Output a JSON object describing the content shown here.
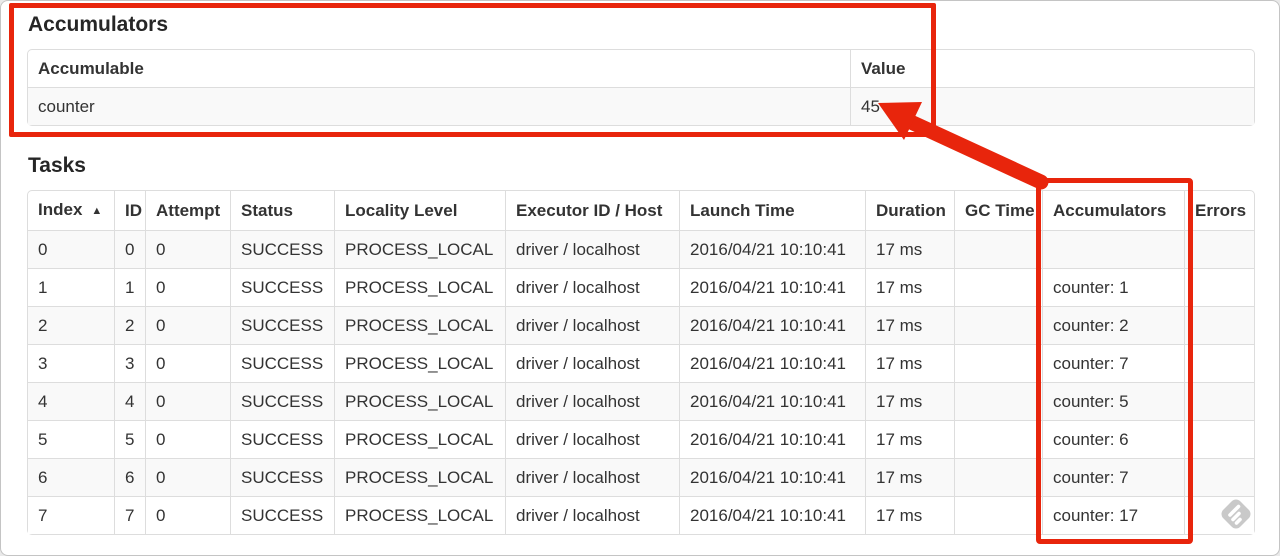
{
  "annotation": {
    "color": "#e8250c"
  },
  "watermark": {
    "color": "#c9c9c9"
  },
  "accumulators_section": {
    "title": "Accumulators",
    "table": {
      "columns": [
        "Accumulable",
        "Value"
      ],
      "rows": [
        [
          "counter",
          "45"
        ]
      ]
    }
  },
  "tasks_section": {
    "title": "Tasks",
    "table": {
      "columns": [
        "Index",
        "ID",
        "Attempt",
        "Status",
        "Locality Level",
        "Executor ID / Host",
        "Launch Time",
        "Duration",
        "GC Time",
        "Accumulators",
        "Errors"
      ],
      "sort_column": "Index",
      "sort_icon": "▲",
      "rows": [
        [
          "0",
          "0",
          "0",
          "SUCCESS",
          "PROCESS_LOCAL",
          "driver / localhost",
          "2016/04/21 10:10:41",
          "17 ms",
          "",
          "",
          ""
        ],
        [
          "1",
          "1",
          "0",
          "SUCCESS",
          "PROCESS_LOCAL",
          "driver / localhost",
          "2016/04/21 10:10:41",
          "17 ms",
          "",
          "counter: 1",
          ""
        ],
        [
          "2",
          "2",
          "0",
          "SUCCESS",
          "PROCESS_LOCAL",
          "driver / localhost",
          "2016/04/21 10:10:41",
          "17 ms",
          "",
          "counter: 2",
          ""
        ],
        [
          "3",
          "3",
          "0",
          "SUCCESS",
          "PROCESS_LOCAL",
          "driver / localhost",
          "2016/04/21 10:10:41",
          "17 ms",
          "",
          "counter: 7",
          ""
        ],
        [
          "4",
          "4",
          "0",
          "SUCCESS",
          "PROCESS_LOCAL",
          "driver / localhost",
          "2016/04/21 10:10:41",
          "17 ms",
          "",
          "counter: 5",
          ""
        ],
        [
          "5",
          "5",
          "0",
          "SUCCESS",
          "PROCESS_LOCAL",
          "driver / localhost",
          "2016/04/21 10:10:41",
          "17 ms",
          "",
          "counter: 6",
          ""
        ],
        [
          "6",
          "6",
          "0",
          "SUCCESS",
          "PROCESS_LOCAL",
          "driver / localhost",
          "2016/04/21 10:10:41",
          "17 ms",
          "",
          "counter: 7",
          ""
        ],
        [
          "7",
          "7",
          "0",
          "SUCCESS",
          "PROCESS_LOCAL",
          "driver / localhost",
          "2016/04/21 10:10:41",
          "17 ms",
          "",
          "counter: 17",
          ""
        ]
      ]
    }
  }
}
